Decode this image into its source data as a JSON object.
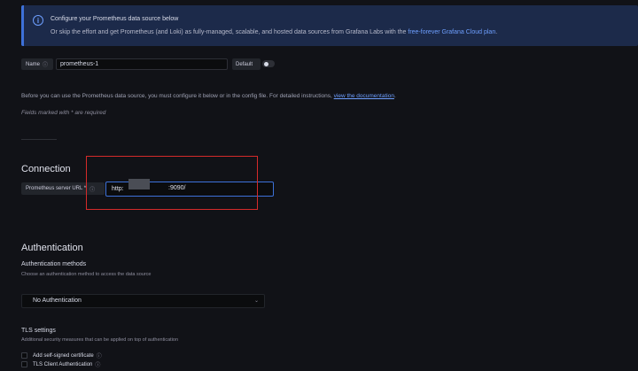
{
  "banner": {
    "title": "Configure your Prometheus data source below",
    "text": "Or skip the effort and get Prometheus (and Loki) as fully-managed, scalable, and hosted data sources from Grafana Labs with the ",
    "link": "free-forever Grafana Cloud plan",
    "text_end": "."
  },
  "settings": {
    "name_label": "Name",
    "name_value": "prometheus-1",
    "default_label": "Default",
    "default_on": false
  },
  "intro": {
    "text": "Before you can use the Prometheus data source, you must configure it below or in the config file. For detailed instructions, ",
    "link": "view the documentation",
    "text_end": ".",
    "required_note": "Fields marked with * are required"
  },
  "connection": {
    "heading": "Connection",
    "url_label": "Prometheus server URL *",
    "url_prefix": "http:",
    "url_port": ":9090/"
  },
  "authentication": {
    "heading": "Authentication",
    "methods_label": "Authentication methods",
    "methods_desc": "Choose an authentication method to access the data source",
    "selected_method": "No Authentication",
    "tls_label": "TLS settings",
    "tls_desc": "Additional security measures that can be applied on top of authentication",
    "options": [
      {
        "label": "Add self-signed certificate"
      },
      {
        "label": "TLS Client Authentication"
      }
    ]
  },
  "icons": {
    "info": "info-icon",
    "chevron": "chevron-down-icon"
  },
  "colors": {
    "accent": "#3d71d9",
    "highlight": "#d42a2a"
  }
}
